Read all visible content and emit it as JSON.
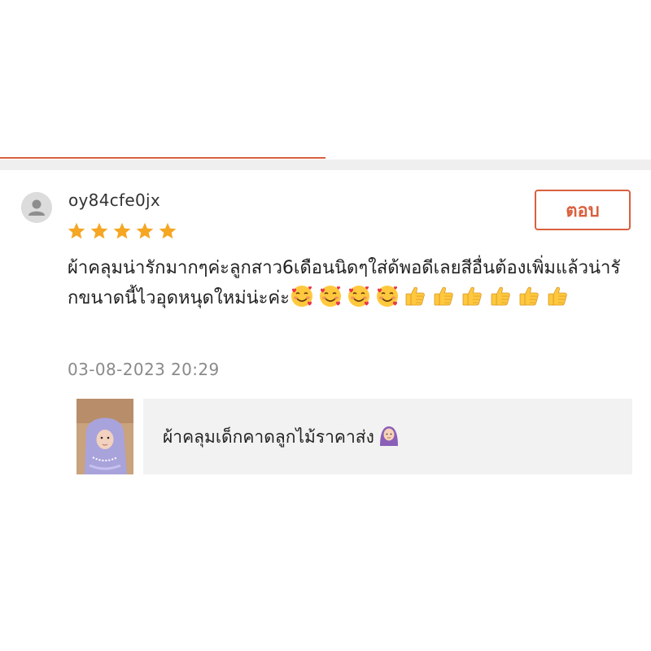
{
  "review": {
    "username": "oy84cfe0jx",
    "rating": 5,
    "text": "ผ้าคลุมน่ารักมากๆค่ะลูกสาว6เดือนนิดๆใส่ด้พอดีเลยสีอื่นต้องเพิ่มแล้วน่ารักขนาดนี้ไวอุดหนุดใหม่น่ะค่ะ",
    "emojis": [
      "smiling-face-with-hearts",
      "smiling-face-with-hearts",
      "smiling-face-with-hearts",
      "smiling-face-with-hearts",
      "thumbs-up",
      "thumbs-up",
      "thumbs-up",
      "thumbs-up",
      "thumbs-up",
      "thumbs-up"
    ],
    "timestamp": "03-08-2023 20:29",
    "reply_label": "ตอบ"
  },
  "product": {
    "title": "ผ้าคลุมเด็กคาดลูกไม้ราคาส่ง",
    "title_emoji": "woman-with-headscarf"
  },
  "colors": {
    "accent": "#d9603f",
    "star": "#f5a623",
    "separator": "#efefef",
    "card_bg": "#f2f2f2",
    "timestamp": "#8a8a8a"
  }
}
